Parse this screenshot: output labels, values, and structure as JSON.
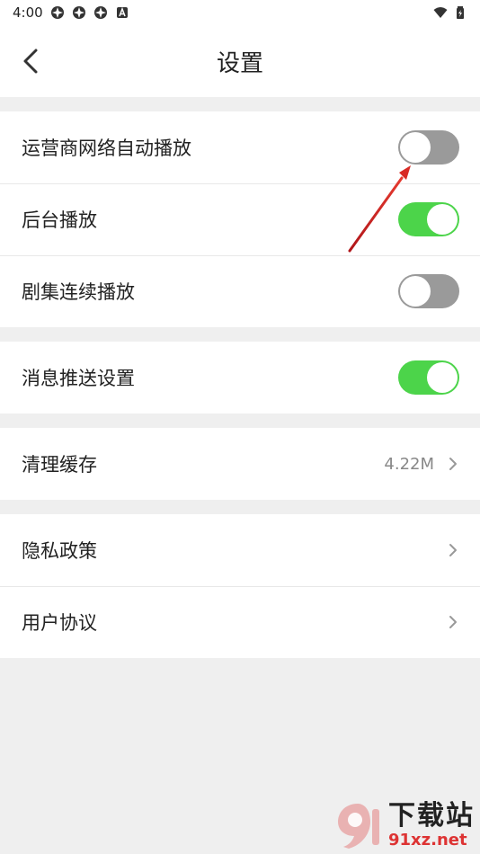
{
  "status_bar": {
    "time": "4:00",
    "icons": [
      "app-notification-icon",
      "app-notification-icon",
      "app-notification-icon",
      "a-notification-icon"
    ],
    "right_icons": [
      "wifi-icon",
      "battery-icon"
    ]
  },
  "header": {
    "title": "设置",
    "back_icon": "chevron-left-icon"
  },
  "groups": [
    {
      "rows": [
        {
          "label": "运营商网络自动播放",
          "control": "toggle",
          "state": "off"
        },
        {
          "label": "后台播放",
          "control": "toggle",
          "state": "on"
        },
        {
          "label": "剧集连续播放",
          "control": "toggle",
          "state": "off"
        }
      ]
    },
    {
      "rows": [
        {
          "label": "消息推送设置",
          "control": "toggle",
          "state": "on"
        }
      ]
    },
    {
      "rows": [
        {
          "label": "清理缓存",
          "control": "value-chevron",
          "value": "4.22M"
        }
      ]
    },
    {
      "rows": [
        {
          "label": "隐私政策",
          "control": "chevron"
        },
        {
          "label": "用户协议",
          "control": "chevron"
        }
      ]
    }
  ],
  "colors": {
    "toggle_on": "#4cd44a",
    "toggle_off": "#9a9a9a",
    "annotation_arrow": "#d21f1f",
    "background": "#efefef"
  },
  "watermark": {
    "text": "下载站",
    "url": "91xz.net"
  }
}
